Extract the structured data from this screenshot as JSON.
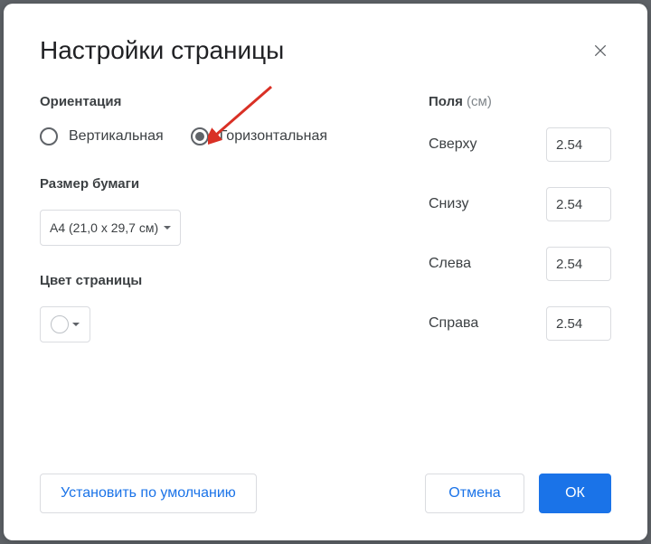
{
  "dialog": {
    "title": "Настройки страницы"
  },
  "orientation": {
    "title": "Ориентация",
    "options": {
      "portrait": "Вертикальная",
      "landscape": "Горизонтальная"
    }
  },
  "paperSize": {
    "title": "Размер бумаги",
    "selected": "A4 (21,0 x 29,7 см)"
  },
  "pageColor": {
    "title": "Цвет страницы",
    "value": "#ffffff"
  },
  "margins": {
    "title": "Поля",
    "unit": "(см)",
    "top": {
      "label": "Сверху",
      "value": "2.54"
    },
    "bottom": {
      "label": "Снизу",
      "value": "2.54"
    },
    "left": {
      "label": "Слева",
      "value": "2.54"
    },
    "right": {
      "label": "Справа",
      "value": "2.54"
    }
  },
  "buttons": {
    "setDefault": "Установить по умолчанию",
    "cancel": "Отмена",
    "ok": "ОК"
  }
}
